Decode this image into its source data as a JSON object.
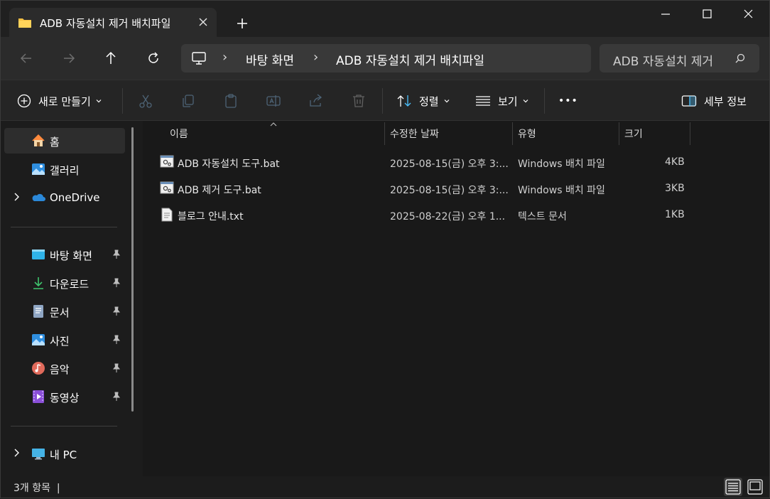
{
  "tab": {
    "title": "ADB 자동설치 제거 배치파일"
  },
  "address": {
    "crumbs": [
      "바탕 화면",
      "ADB 자동설치 제거 배치파일"
    ]
  },
  "search": {
    "text": "ADB 자동설치 제거"
  },
  "toolbar": {
    "new_label": "새로 만들기",
    "sort_label": "정렬",
    "view_label": "보기",
    "more_label": "•••",
    "details_label": "세부 정보"
  },
  "sidebar": {
    "items": [
      {
        "label": "홈",
        "icon": "home-icon"
      },
      {
        "label": "갤러리",
        "icon": "gallery-icon"
      },
      {
        "label": "OneDrive",
        "icon": "onedrive-icon"
      },
      {
        "label": "바탕 화면",
        "icon": "desktop-icon"
      },
      {
        "label": "다운로드",
        "icon": "download-icon"
      },
      {
        "label": "문서",
        "icon": "documents-icon"
      },
      {
        "label": "사진",
        "icon": "pictures-icon"
      },
      {
        "label": "음악",
        "icon": "music-icon"
      },
      {
        "label": "동영상",
        "icon": "videos-icon"
      },
      {
        "label": "내 PC",
        "icon": "this-pc-icon"
      }
    ]
  },
  "columns": {
    "name": "이름",
    "date": "수정한 날짜",
    "type": "유형",
    "size": "크기"
  },
  "files": [
    {
      "name": "ADB 자동설치 도구.bat",
      "date": "2025-08-15(금) 오후 3:...",
      "type": "Windows 배치 파일",
      "size": "4KB",
      "icon": "batch-file-icon"
    },
    {
      "name": "ADB 제거 도구.bat",
      "date": "2025-08-15(금) 오후 3:...",
      "type": "Windows 배치 파일",
      "size": "3KB",
      "icon": "batch-file-icon"
    },
    {
      "name": "블로그 안내.txt",
      "date": "2025-08-22(금) 오후 1...",
      "type": "텍스트 문서",
      "size": "1KB",
      "icon": "text-file-icon"
    }
  ],
  "status": {
    "count": "3개 항목"
  },
  "colors": {
    "accent": "#4cc2ff",
    "folder": "#f5c044",
    "background": "#191919"
  }
}
